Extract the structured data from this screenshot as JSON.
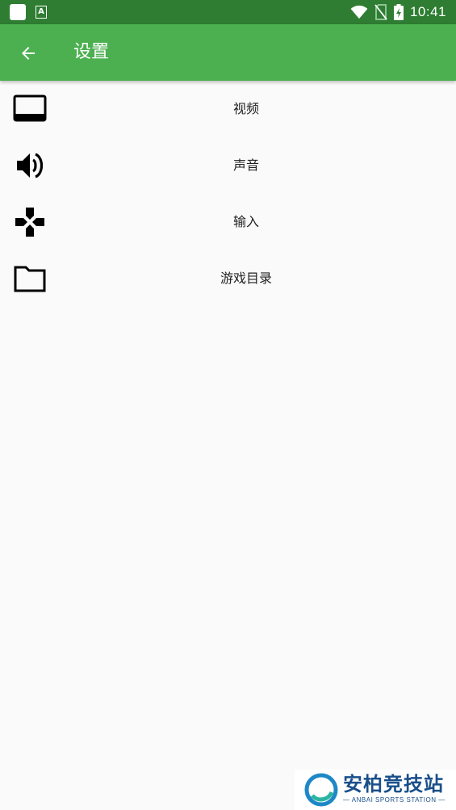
{
  "status_bar": {
    "time": "10:41",
    "notification_icons": [
      "app-notification-icon",
      "accessibility-a-icon"
    ],
    "system_icons": [
      "wifi-icon",
      "no-sim-icon",
      "battery-charging-icon"
    ]
  },
  "app_bar": {
    "back_icon": "arrow-back-icon",
    "title": "设置"
  },
  "settings": {
    "items": [
      {
        "label": "视频",
        "icon": "monitor-icon"
      },
      {
        "label": "声音",
        "icon": "volume-icon"
      },
      {
        "label": "输入",
        "icon": "gamepad-icon"
      },
      {
        "label": "游戏目录",
        "icon": "folder-icon"
      }
    ]
  },
  "watermark": {
    "title": "安柏竞技站",
    "subtitle": "— ANBAI SPORTS STATION —"
  },
  "colors": {
    "status_bar": "#2e7d32",
    "app_bar": "#4caf50",
    "background": "#fafafa",
    "text": "#222222",
    "watermark_text": "#1a4f8a"
  }
}
